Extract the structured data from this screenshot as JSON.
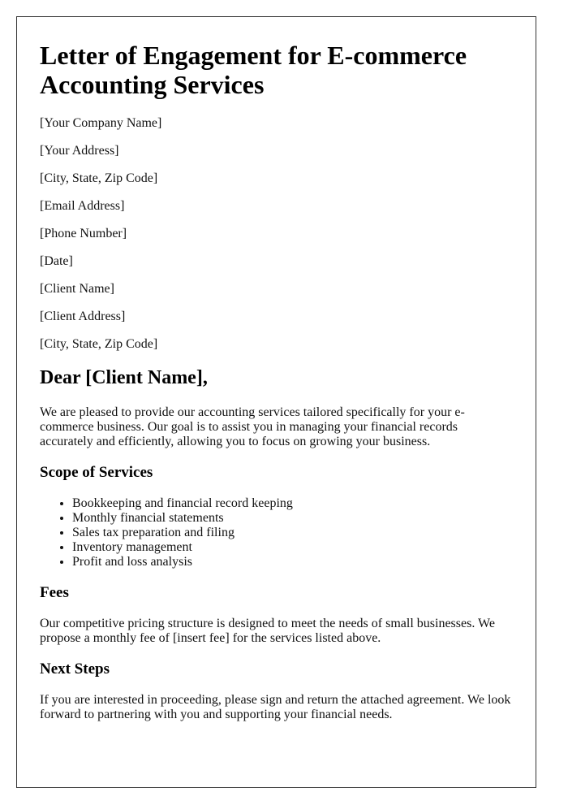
{
  "letter": {
    "title": "Letter of Engagement for E-commerce Accounting Services",
    "sender": [
      "[Your Company Name]",
      "[Your Address]",
      "[City, State, Zip Code]",
      "[Email Address]",
      "[Phone Number]"
    ],
    "date": "[Date]",
    "recipient": [
      "[Client Name]",
      "[Client Address]",
      "[City, State, Zip Code]"
    ],
    "salutation": "Dear [Client Name],",
    "intro": "We are pleased to provide our accounting services tailored specifically for your e-commerce business. Our goal is to assist you in managing your financial records accurately and efficiently, allowing you to focus on growing your business.",
    "scope": {
      "heading": "Scope of Services",
      "items": [
        "Bookkeeping and financial record keeping",
        "Monthly financial statements",
        "Sales tax preparation and filing",
        "Inventory management",
        "Profit and loss analysis"
      ]
    },
    "fees": {
      "heading": "Fees",
      "text": "Our competitive pricing structure is designed to meet the needs of small businesses. We propose a monthly fee of [insert fee] for the services listed above."
    },
    "next_steps": {
      "heading": "Next Steps",
      "text": "If you are interested in proceeding, please sign and return the attached agreement. We look forward to partnering with you and supporting your financial needs."
    }
  }
}
